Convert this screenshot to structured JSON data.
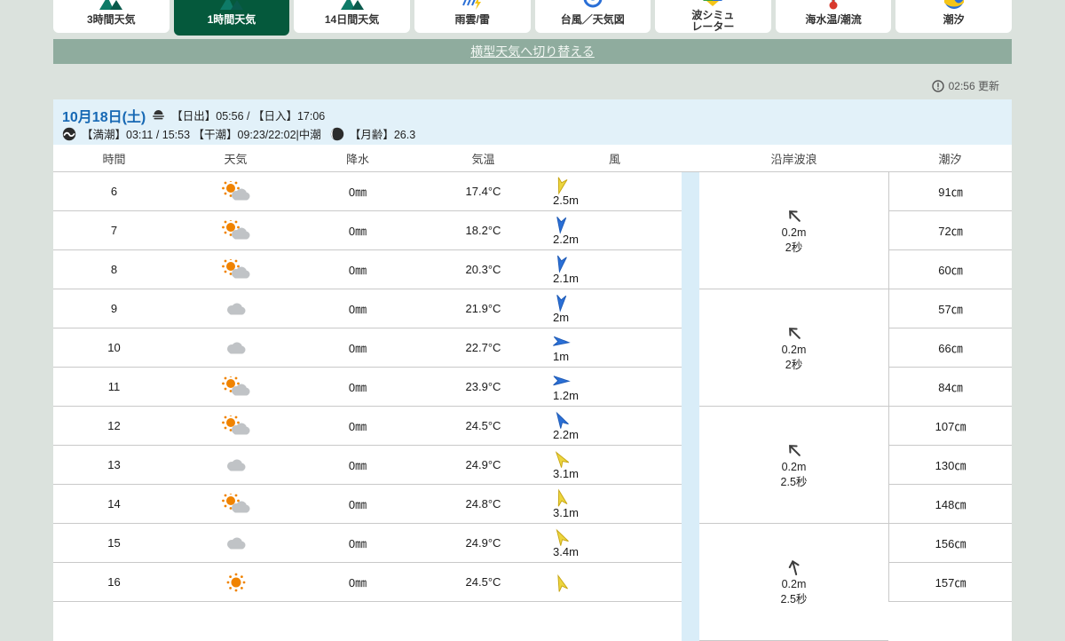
{
  "tabs": [
    {
      "label": "3時間天気",
      "icon": "weather-mountain-icon",
      "active": false
    },
    {
      "label": "1時間天気",
      "icon": "weather-mountain-icon",
      "active": true
    },
    {
      "label": "14日間天気",
      "icon": "weather-mountain-icon",
      "active": false
    },
    {
      "label": "雨雲/雷",
      "icon": "rain-lightning-icon",
      "active": false
    },
    {
      "label": "台風／天気図",
      "icon": "typhoon-icon",
      "active": false
    },
    {
      "label": "波シミュ\nレーター",
      "icon": "wave-sim-icon",
      "active": false
    },
    {
      "label": "海水温/潮流",
      "icon": "sea-temp-icon",
      "active": false
    },
    {
      "label": "潮汐",
      "icon": "tide-icon",
      "active": false
    }
  ],
  "switch_bar": {
    "label": "横型天気へ切り替える"
  },
  "updated": "02:56 更新",
  "date_header": {
    "date": "10月18日(土)",
    "sun_info": "【日出】05:56 / 【日入】17:06",
    "tide_info": "【満潮】03:11 / 15:53 【干潮】09:23/22:02|中潮",
    "moon_info": "【月齢】26.3"
  },
  "colors": {
    "active_tab": "#05593c",
    "switch_bar": "#8fac9e",
    "date_band": "#e2f1f9",
    "wave_strip": "#d9edf8",
    "wind_slow": "#2a6fd6",
    "wind_fast": "#ecd53e",
    "date_text": "#1668b4"
  },
  "table": {
    "headers": [
      "時間",
      "天気",
      "降水",
      "気温",
      "風",
      "沿岸波浪",
      "潮汐"
    ],
    "rows": [
      {
        "hour": "6",
        "weather": "partly",
        "precip": "0㎜",
        "temp": "17.4°C",
        "wind": {
          "speed": "2.5m",
          "color": "yellow",
          "dir": 195
        },
        "tide": "91㎝"
      },
      {
        "hour": "7",
        "weather": "partly",
        "precip": "0㎜",
        "temp": "18.2°C",
        "wind": {
          "speed": "2.2m",
          "color": "blue",
          "dir": 185
        },
        "tide": "72㎝"
      },
      {
        "hour": "8",
        "weather": "partly",
        "precip": "0㎜",
        "temp": "20.3°C",
        "wind": {
          "speed": "2.1m",
          "color": "blue",
          "dir": 190
        },
        "tide": "60㎝"
      },
      {
        "hour": "9",
        "weather": "cloudy",
        "precip": "0㎜",
        "temp": "21.9°C",
        "wind": {
          "speed": "2m",
          "color": "blue",
          "dir": 185
        },
        "tide": "57㎝"
      },
      {
        "hour": "10",
        "weather": "cloudy",
        "precip": "0㎜",
        "temp": "22.7°C",
        "wind": {
          "speed": "1m",
          "color": "blue",
          "dir": 95
        },
        "tide": "66㎝"
      },
      {
        "hour": "11",
        "weather": "partly",
        "precip": "0㎜",
        "temp": "23.9°C",
        "wind": {
          "speed": "1.2m",
          "color": "blue",
          "dir": 92
        },
        "tide": "84㎝"
      },
      {
        "hour": "12",
        "weather": "partly",
        "precip": "0㎜",
        "temp": "24.5°C",
        "wind": {
          "speed": "2.2m",
          "color": "blue",
          "dir": 330
        },
        "tide": "107㎝"
      },
      {
        "hour": "13",
        "weather": "cloudy",
        "precip": "0㎜",
        "temp": "24.9°C",
        "wind": {
          "speed": "3.1m",
          "color": "yellow",
          "dir": 325
        },
        "tide": "130㎝"
      },
      {
        "hour": "14",
        "weather": "partly",
        "precip": "0㎜",
        "temp": "24.8°C",
        "wind": {
          "speed": "3.1m",
          "color": "yellow",
          "dir": 345
        },
        "tide": "148㎝"
      },
      {
        "hour": "15",
        "weather": "cloudy",
        "precip": "0㎜",
        "temp": "24.9°C",
        "wind": {
          "speed": "3.4m",
          "color": "yellow",
          "dir": 330
        },
        "tide": "156㎝"
      },
      {
        "hour": "16",
        "weather": "sunny",
        "precip": "0㎜",
        "temp": "24.5°C",
        "wind": {
          "speed": "",
          "color": "yellow",
          "dir": 340
        },
        "tide": "157㎝"
      }
    ],
    "wave_groups": [
      {
        "height": "0.2m",
        "period": "2秒",
        "dir": -45,
        "span": 3
      },
      {
        "height": "0.2m",
        "period": "2秒",
        "dir": -45,
        "span": 3
      },
      {
        "height": "0.2m",
        "period": "2.5秒",
        "dir": -45,
        "span": 3
      },
      {
        "height": "0.2m",
        "period": "2.5秒",
        "dir": -15,
        "span": 3
      }
    ]
  }
}
